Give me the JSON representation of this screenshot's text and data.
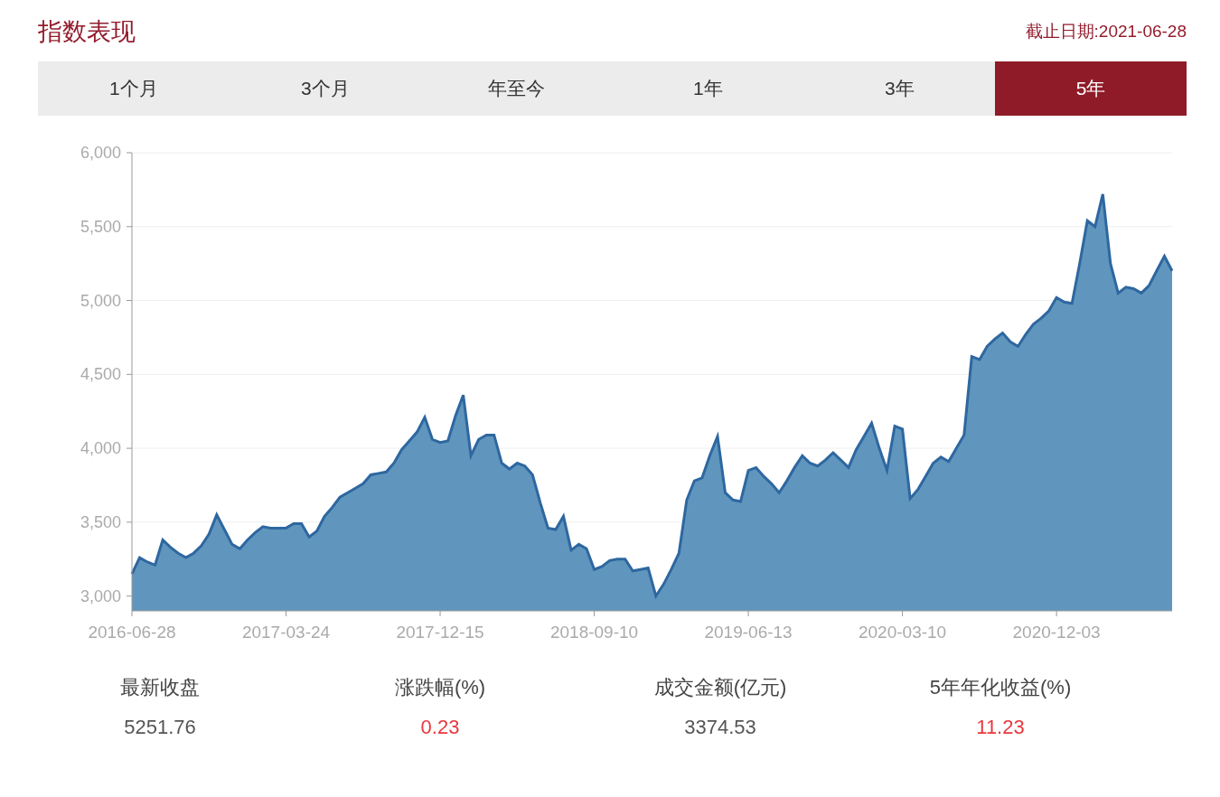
{
  "header": {
    "title": "指数表现",
    "as_of": "截止日期:2021-06-28"
  },
  "tabs": [
    {
      "label": "1个月",
      "selected": false
    },
    {
      "label": "3个月",
      "selected": false
    },
    {
      "label": "年至今",
      "selected": false
    },
    {
      "label": "1年",
      "selected": false
    },
    {
      "label": "3年",
      "selected": false
    },
    {
      "label": "5年",
      "selected": true
    }
  ],
  "chart": {
    "chart_data": {
      "type": "area",
      "categories": [
        "2016-06-28",
        null,
        null,
        null,
        null,
        null,
        null,
        null,
        null,
        null,
        null,
        null,
        null,
        null,
        null,
        null,
        null,
        null,
        null,
        null,
        "2017-03-24",
        null,
        null,
        null,
        null,
        null,
        null,
        null,
        null,
        null,
        null,
        null,
        null,
        null,
        null,
        null,
        null,
        null,
        null,
        null,
        "2017-12-15",
        null,
        null,
        null,
        null,
        null,
        null,
        null,
        null,
        null,
        null,
        null,
        null,
        null,
        null,
        null,
        null,
        null,
        null,
        null,
        "2018-09-10",
        null,
        null,
        null,
        null,
        null,
        null,
        null,
        null,
        null,
        null,
        null,
        null,
        null,
        null,
        null,
        null,
        null,
        null,
        null,
        "2019-06-13",
        null,
        null,
        null,
        null,
        null,
        null,
        null,
        null,
        null,
        null,
        null,
        null,
        null,
        null,
        null,
        null,
        null,
        null,
        null,
        "2020-03-10",
        null,
        null,
        null,
        null,
        null,
        null,
        null,
        null,
        null,
        null,
        null,
        null,
        null,
        null,
        null,
        null,
        null,
        null,
        null,
        "2020-12-03",
        null,
        null,
        null,
        null,
        null,
        null,
        null,
        null,
        null,
        null,
        null,
        null,
        null,
        null,
        null
      ],
      "series": [
        {
          "color": "#2e67a0",
          "values": [
            3150,
            3260,
            3230,
            3210,
            3380,
            3330,
            3290,
            3260,
            3290,
            3340,
            3420,
            3550,
            3450,
            3350,
            3320,
            3380,
            3430,
            3470,
            3460,
            3460,
            3460,
            3490,
            3490,
            3400,
            3440,
            3540,
            3600,
            3670,
            3700,
            3730,
            3760,
            3820,
            3830,
            3840,
            3900,
            3990,
            4050,
            4110,
            4210,
            4060,
            4040,
            4050,
            4220,
            4360,
            3950,
            4060,
            4090,
            4090,
            3900,
            3860,
            3900,
            3880,
            3820,
            3630,
            3460,
            3450,
            3540,
            3310,
            3350,
            3320,
            3180,
            3200,
            3240,
            3250,
            3250,
            3170,
            3180,
            3190,
            3000,
            3080,
            3180,
            3290,
            3650,
            3780,
            3800,
            3950,
            4080,
            3700,
            3650,
            3640,
            3850,
            3870,
            3810,
            3760,
            3700,
            3780,
            3870,
            3950,
            3900,
            3880,
            3920,
            3970,
            3920,
            3870,
            3990,
            4080,
            4170,
            4000,
            3850,
            4150,
            4130,
            3660,
            3720,
            3810,
            3900,
            3940,
            3910,
            4000,
            4090,
            4620,
            4600,
            4690,
            4740,
            4780,
            4720,
            4690,
            4770,
            4840,
            4880,
            4930,
            5020,
            4990,
            4980,
            5250,
            5540,
            5500,
            5720,
            5250,
            5050,
            5090,
            5080,
            5050,
            5100,
            5200,
            5300,
            5200
          ]
        }
      ],
      "ylim": [
        2900,
        6000
      ],
      "grid": true,
      "yticks": [
        {
          "value": 3000,
          "label": "3,000"
        },
        {
          "value": 3500,
          "label": "3,500"
        },
        {
          "value": 4000,
          "label": "4,000"
        },
        {
          "value": 4500,
          "label": "4,500"
        },
        {
          "value": 5000,
          "label": "5,000"
        },
        {
          "value": 5500,
          "label": "5,500"
        },
        {
          "value": 6000,
          "label": "6,000"
        }
      ]
    }
  },
  "stats": [
    {
      "label": "最新收盘",
      "value": "5251.76",
      "color": "#555555"
    },
    {
      "label": "涨跌幅(%)",
      "value": "0.23",
      "color": "#e8383d"
    },
    {
      "label": "成交金额(亿元)",
      "value": "3374.53",
      "color": "#555555"
    },
    {
      "label": "5年年化收益(%)",
      "value": "11.23",
      "color": "#e8383d"
    }
  ]
}
